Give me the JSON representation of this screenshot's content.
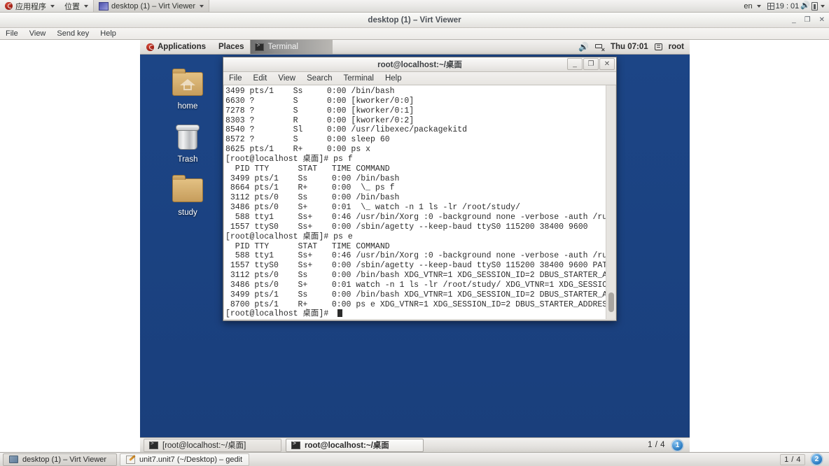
{
  "host_panel": {
    "applications_label": "应用程序",
    "places_label": "位置",
    "active_window_label": "desktop (1) – Virt Viewer",
    "keyboard_layout": "en",
    "clock": "19 : 01"
  },
  "virt_viewer": {
    "title": "desktop (1) – Virt Viewer",
    "menus": [
      "File",
      "View",
      "Send key",
      "Help"
    ],
    "window_buttons": {
      "minimize": "_",
      "maximize": "❐",
      "close": "✕"
    }
  },
  "guest_panel": {
    "applications_label": "Applications",
    "places_label": "Places",
    "active_window": "Terminal",
    "clock": "Thu 07:01",
    "user": "root"
  },
  "desktop_icons": [
    {
      "name": "home",
      "label": "home",
      "icon": "home-folder-icon"
    },
    {
      "name": "trash",
      "label": "Trash",
      "icon": "trash-icon"
    },
    {
      "name": "study",
      "label": "study",
      "icon": "folder-icon"
    }
  ],
  "terminal": {
    "title": "root@localhost:~/桌面",
    "menus": [
      "File",
      "Edit",
      "View",
      "Search",
      "Terminal",
      "Help"
    ],
    "window_buttons": {
      "minimize": "_",
      "maximize": "❐",
      "close": "✕"
    },
    "content": "3499 pts/1    Ss     0:00 /bin/bash\n6630 ?        S      0:00 [kworker/0:0]\n7278 ?        S      0:00 [kworker/0:1]\n8303 ?        R      0:00 [kworker/0:2]\n8540 ?        Sl     0:00 /usr/libexec/packagekitd\n8572 ?        S      0:00 sleep 60\n8625 pts/1    R+     0:00 ps x\n[root@localhost 桌面]# ps f\n  PID TTY      STAT   TIME COMMAND\n 3499 pts/1    Ss     0:00 /bin/bash\n 8664 pts/1    R+     0:00  \\_ ps f\n 3112 pts/0    Ss     0:00 /bin/bash\n 3486 pts/0    S+     0:01  \\_ watch -n 1 ls -lr /root/study/\n  588 tty1     Ss+    0:46 /usr/bin/Xorg :0 -background none -verbose -auth /run\n 1557 ttyS0    Ss+    0:00 /sbin/agetty --keep-baud ttyS0 115200 38400 9600\n[root@localhost 桌面]# ps e\n  PID TTY      STAT   TIME COMMAND\n  588 tty1     Ss+    0:46 /usr/bin/Xorg :0 -background none -verbose -auth /run\n 1557 ttyS0    Ss+    0:00 /sbin/agetty --keep-baud ttyS0 115200 38400 9600 PATH\n 3112 pts/0    Ss     0:00 /bin/bash XDG_VTNR=1 XDG_SESSION_ID=2 DBUS_STARTER_AD\n 3486 pts/0    S+     0:01 watch -n 1 ls -lr /root/study/ XDG_VTNR=1 XDG_SESSION\n 3499 pts/1    Ss     0:00 /bin/bash XDG_VTNR=1 XDG_SESSION_ID=2 DBUS_STARTER_AD\n 8700 pts/1    R+     0:00 ps e XDG_VTNR=1 XDG_SESSION_ID=2 DBUS_STARTER_ADDRESS\n[root@localhost 桌面]# ",
    "prompt_last": "[root@localhost 桌面]# "
  },
  "guest_taskbar": {
    "items": [
      {
        "label": "[root@localhost:~/桌面]",
        "state": "inactive"
      },
      {
        "label": "root@localhost:~/桌面",
        "state": "active"
      }
    ],
    "workspace_count": "1 / 4",
    "workspace_current": "1"
  },
  "host_taskbar": {
    "items": [
      {
        "label": "desktop (1) – Virt Viewer",
        "state": "active"
      },
      {
        "label": "unit7.unit7 (~/Desktop) – gedit",
        "state": "inactive"
      }
    ],
    "workspace_count": "1 / 4",
    "workspace_current": "2"
  },
  "colors": {
    "desktop_blue": "#1c4586",
    "panel_grey": "#e6e4e1",
    "terminal_bg": "#ffffff",
    "terminal_fg": "#2b2b2b",
    "badge_blue": "#2f7fc4"
  }
}
